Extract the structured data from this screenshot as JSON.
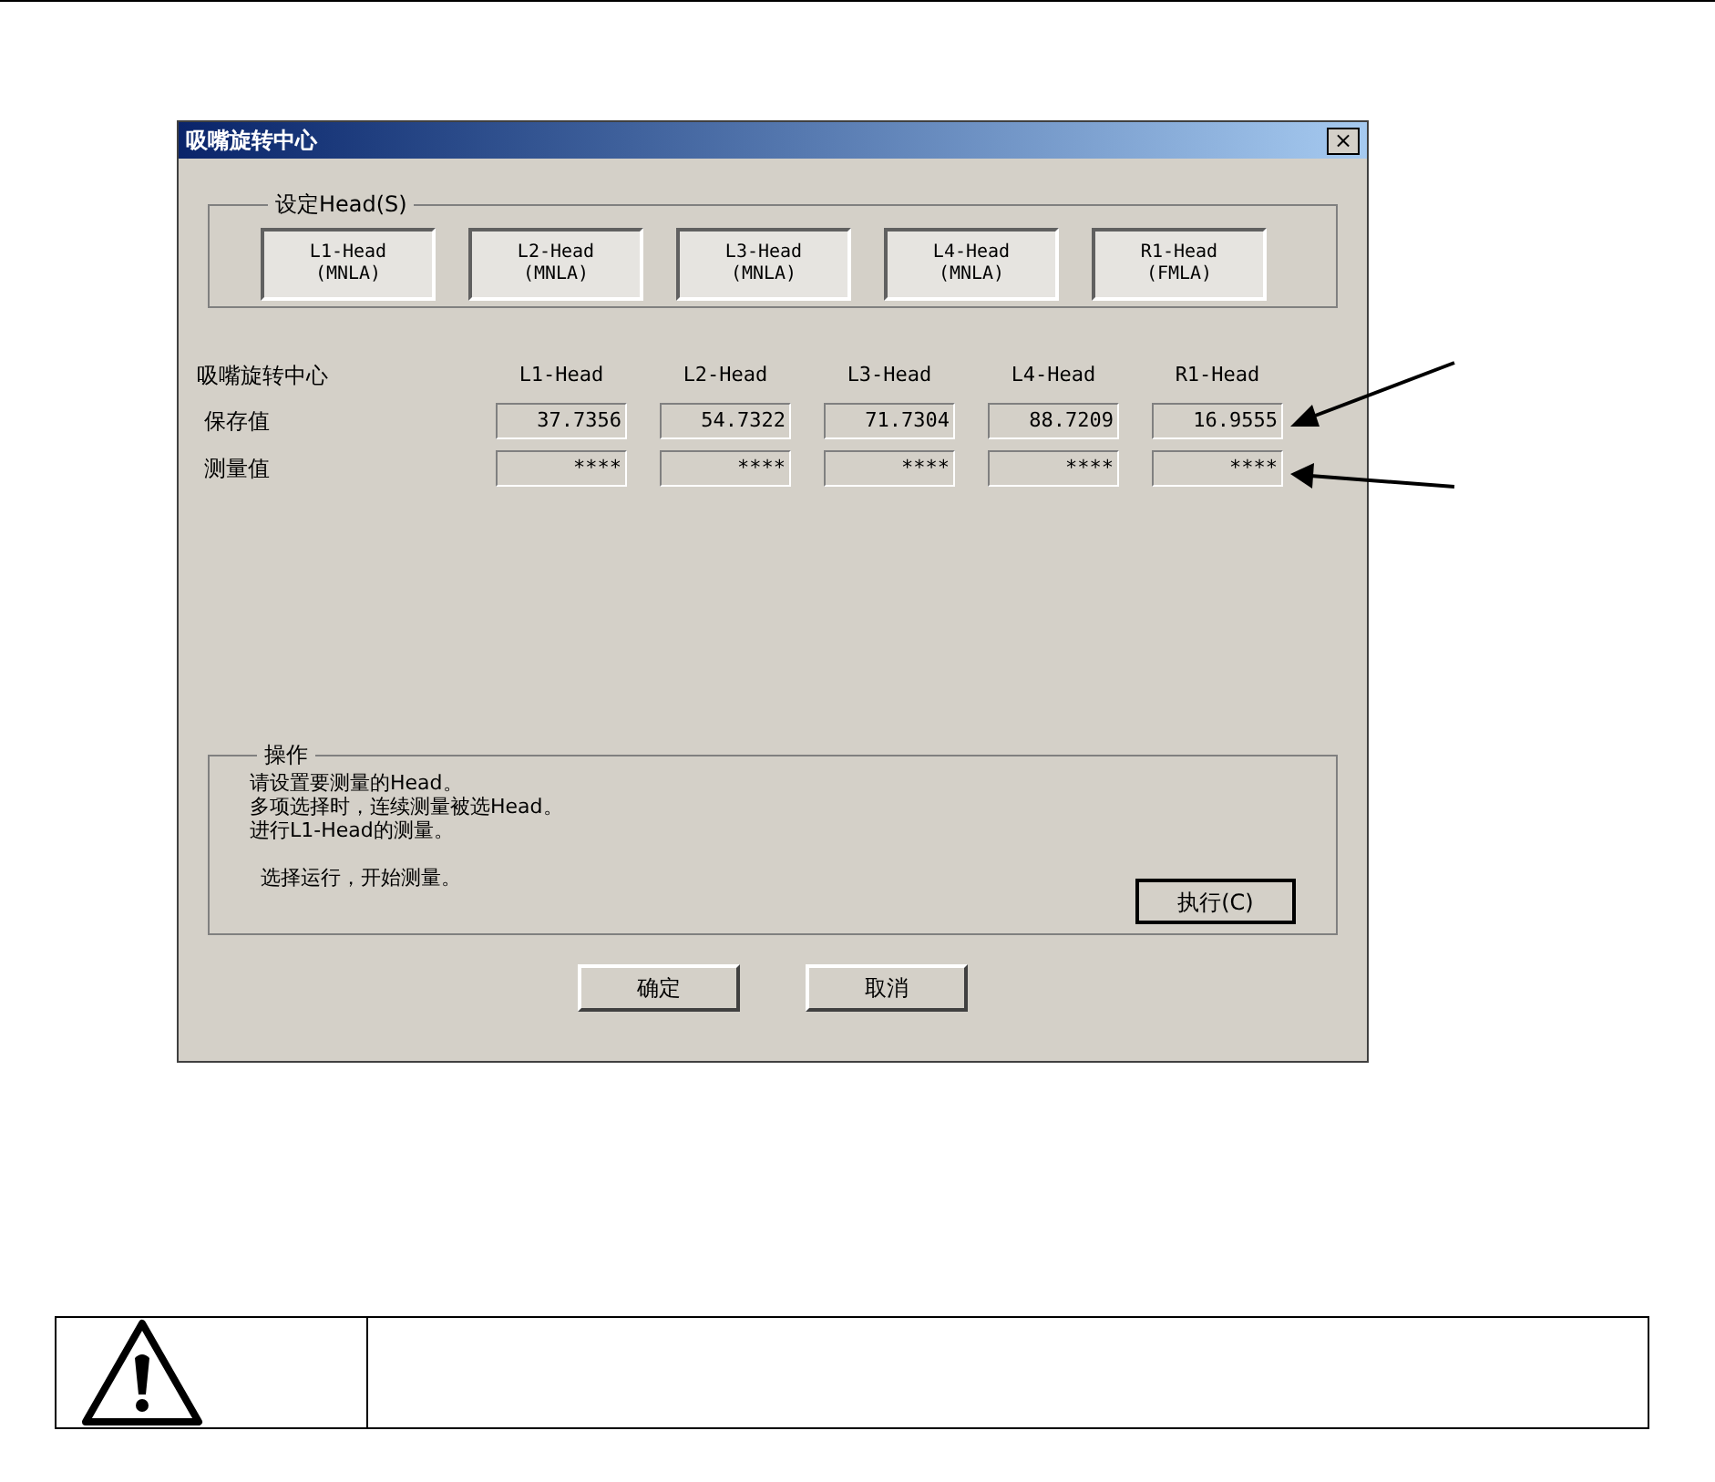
{
  "dialog": {
    "title": "吸嘴旋转中心",
    "close": "×",
    "head_group": {
      "legend": "设定Head(S)",
      "buttons": [
        {
          "line1": "L1-Head",
          "line2": "(MNLA)"
        },
        {
          "line1": "L2-Head",
          "line2": "(MNLA)"
        },
        {
          "line1": "L3-Head",
          "line2": "(MNLA)"
        },
        {
          "line1": "L4-Head",
          "line2": "(MNLA)"
        },
        {
          "line1": "R1-Head",
          "line2": "(FMLA)"
        }
      ]
    },
    "table": {
      "title": "吸嘴旋转中心",
      "columns": [
        "L1-Head",
        "L2-Head",
        "L3-Head",
        "L4-Head",
        "R1-Head"
      ],
      "rows": [
        {
          "label": "保存值",
          "values": [
            "37.7356",
            "54.7322",
            "71.7304",
            "88.7209",
            "16.9555"
          ]
        },
        {
          "label": "测量值",
          "values": [
            "****",
            "****",
            "****",
            "****",
            "****"
          ]
        }
      ]
    },
    "operation": {
      "legend": "操作",
      "lines": [
        "请设置要测量的Head。",
        "多项选择时，连续测量被选Head。",
        "进行L1-Head的测量。"
      ],
      "hint": "选择运行，开始测量。",
      "run_button": "执行(C)"
    },
    "buttons": [
      "确定",
      "取消"
    ]
  }
}
